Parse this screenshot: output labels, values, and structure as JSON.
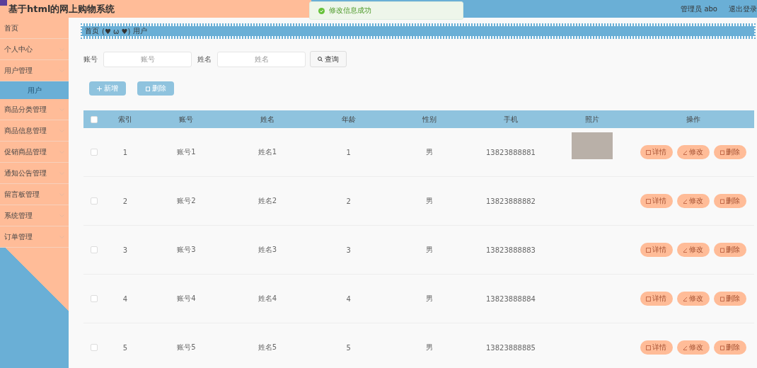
{
  "header": {
    "title": "基于html的网上购物系统",
    "user": "管理员 abo",
    "logout": "退出登录"
  },
  "toast": {
    "message": "修改信息成功"
  },
  "sidebar": {
    "items": [
      {
        "label": "首页"
      },
      {
        "label": "个人中心",
        "expandable": true,
        "expanded": false
      },
      {
        "label": "用户管理",
        "expandable": true,
        "expanded": true,
        "children": [
          {
            "label": "用户",
            "selected": true
          }
        ]
      },
      {
        "label": "商品分类管理",
        "expandable": true,
        "expanded": false
      },
      {
        "label": "商品信息管理",
        "expandable": true,
        "expanded": false
      },
      {
        "label": "促销商品管理",
        "expandable": true,
        "expanded": false
      },
      {
        "label": "通知公告管理",
        "expandable": true,
        "expanded": false
      },
      {
        "label": "留言板管理",
        "expandable": true,
        "expanded": false
      },
      {
        "label": "系统管理",
        "expandable": true,
        "expanded": false
      },
      {
        "label": "订单管理",
        "expandable": true,
        "expanded": false
      }
    ]
  },
  "breadcrumb": {
    "home": "首页",
    "separator": "(♥ ω ♥)",
    "current": "用户"
  },
  "search": {
    "fields": [
      {
        "label": "账号",
        "placeholder": "账号"
      },
      {
        "label": "姓名",
        "placeholder": "姓名"
      }
    ],
    "button": "查询"
  },
  "actions": [
    {
      "kind": "add",
      "label": "新增"
    },
    {
      "kind": "delete",
      "label": "删除"
    }
  ],
  "table": {
    "columns": [
      "索引",
      "账号",
      "姓名",
      "年龄",
      "性别",
      "手机",
      "照片",
      "操作"
    ],
    "all_checked": false,
    "rows": [
      {
        "checked": false,
        "index": "1",
        "account": "账号1",
        "name": "姓名1",
        "age": "1",
        "gender": "男",
        "phone": "13823888881",
        "photo": true,
        "actions": [
          {
            "kind": "detail",
            "label": "详情"
          },
          {
            "kind": "edit",
            "label": "修改"
          },
          {
            "kind": "delete",
            "label": "删除"
          }
        ]
      },
      {
        "checked": false,
        "index": "2",
        "account": "账号2",
        "name": "姓名2",
        "age": "2",
        "gender": "男",
        "phone": "13823888882",
        "photo": false,
        "actions": [
          {
            "kind": "detail",
            "label": "详情"
          },
          {
            "kind": "edit",
            "label": "修改"
          },
          {
            "kind": "delete",
            "label": "删除"
          }
        ]
      },
      {
        "checked": false,
        "index": "3",
        "account": "账号3",
        "name": "姓名3",
        "age": "3",
        "gender": "男",
        "phone": "13823888883",
        "photo": false,
        "actions": [
          {
            "kind": "detail",
            "label": "详情"
          },
          {
            "kind": "edit",
            "label": "修改"
          },
          {
            "kind": "delete",
            "label": "删除"
          }
        ]
      },
      {
        "checked": false,
        "index": "4",
        "account": "账号4",
        "name": "姓名4",
        "age": "4",
        "gender": "男",
        "phone": "13823888884",
        "photo": false,
        "actions": [
          {
            "kind": "detail",
            "label": "详情"
          },
          {
            "kind": "edit",
            "label": "修改"
          },
          {
            "kind": "delete",
            "label": "删除"
          }
        ]
      },
      {
        "checked": false,
        "index": "5",
        "account": "账号5",
        "name": "姓名5",
        "age": "5",
        "gender": "男",
        "phone": "13823888885",
        "photo": false,
        "actions": [
          {
            "kind": "detail",
            "label": "详情"
          },
          {
            "kind": "edit",
            "label": "修改"
          },
          {
            "kind": "delete",
            "label": "删除"
          }
        ]
      }
    ]
  }
}
